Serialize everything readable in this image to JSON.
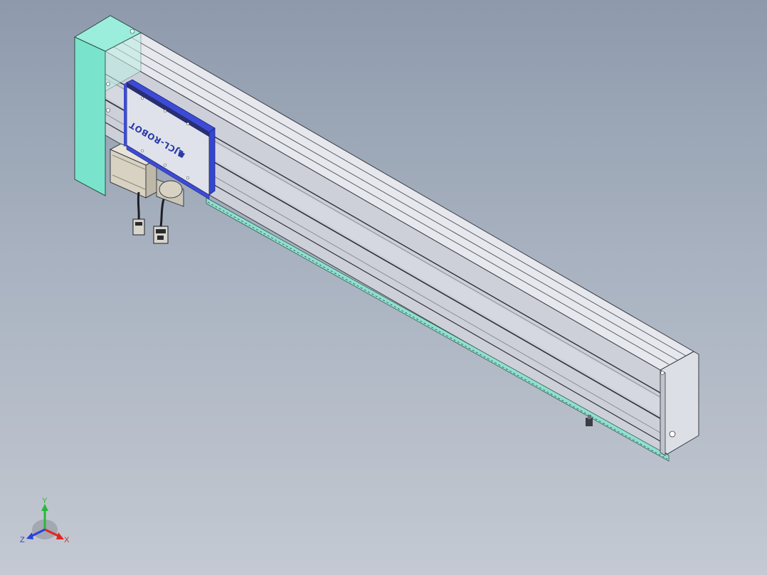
{
  "model": {
    "carriage_logo_text": "LJCL-ROBOT"
  },
  "triad": {
    "x_label": "X",
    "y_label": "Y",
    "z_label": "Z"
  },
  "colors": {
    "background_top": "#8e9aac",
    "background_bottom": "#c4c9d2",
    "end_cap_left": "#7de6cc",
    "rail_body": "#d4d7de",
    "rail_face": "#c9ccd6",
    "carriage_plate": "#dfe2ea",
    "carriage_edge": "#3c4bd6",
    "end_cap_right": "#dcdfe6",
    "motor": "#d7d2c2",
    "axis_x": "#e2261f",
    "axis_y": "#28b83a",
    "axis_z": "#2b42d8"
  }
}
